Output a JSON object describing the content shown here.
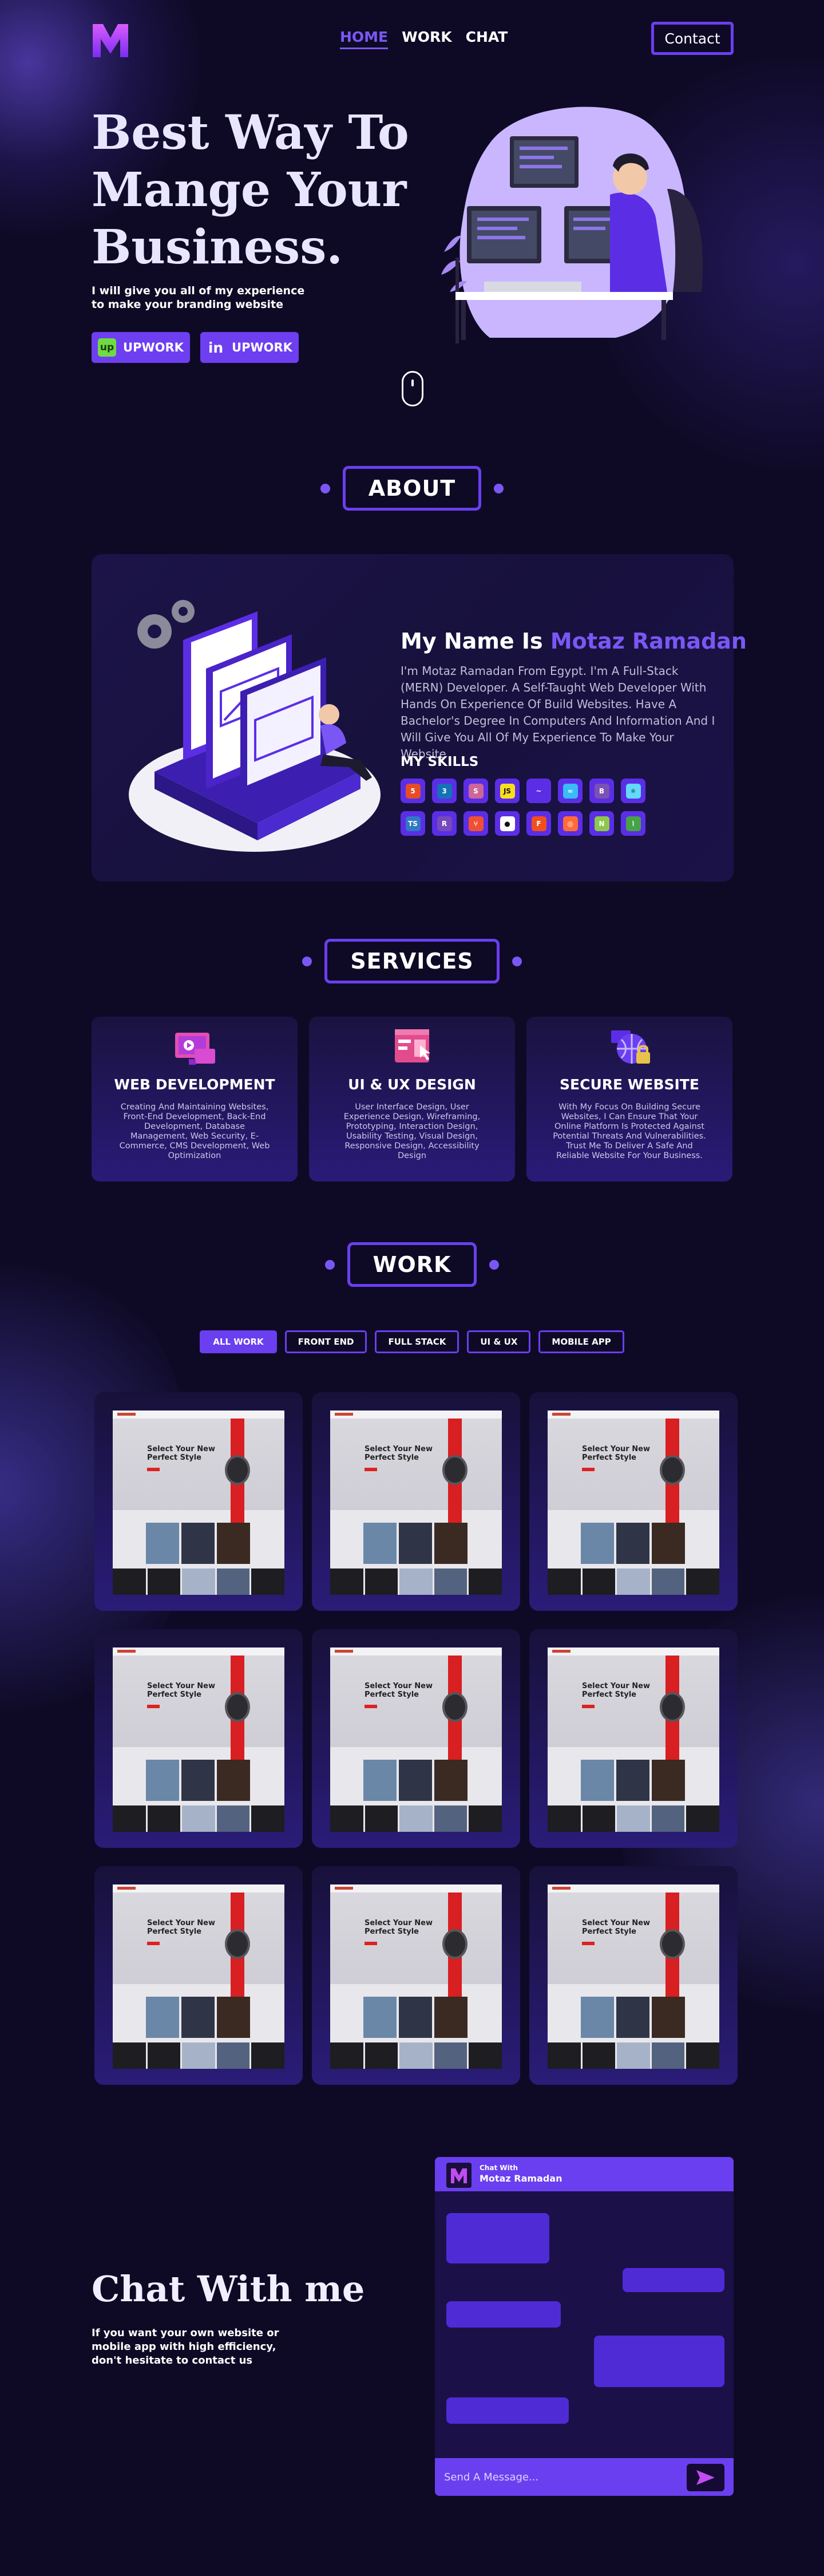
{
  "header": {
    "nav": [
      {
        "label": "HOME",
        "active": true
      },
      {
        "label": "WORK",
        "active": false
      },
      {
        "label": "CHAT",
        "active": false
      }
    ],
    "contact_label": "Contact"
  },
  "hero": {
    "title": "Best Way To Mange Your Business.",
    "subtitle": "I will give you all of my experience to make your branding website",
    "buttons": [
      {
        "label": "UPWORK",
        "icon": "upwork-icon"
      },
      {
        "label": "UPWORK",
        "icon": "linkedin-icon"
      }
    ]
  },
  "about": {
    "section_title": "ABOUT",
    "name_prefix": "My Name Is",
    "name": "Motaz Ramadan",
    "description": "I'm Motaz Ramadan From Egypt. I'm A Full-Stack (MERN) Developer. A Self-Taught Web Developer With Hands On Experience Of Build Websites. Have A Bachelor's Degree In Computers And Information And I Will Give You All Of My Experience To Make Your Website",
    "skills_title": "MY SKILLS",
    "skills": [
      {
        "icon": "html-icon",
        "color": "#e44d26",
        "glyph": "5"
      },
      {
        "icon": "css-icon",
        "color": "#1572b6",
        "glyph": "3"
      },
      {
        "icon": "sass-icon",
        "color": "#cc6699",
        "glyph": "S"
      },
      {
        "icon": "javascript-icon",
        "color": "#f7df1e",
        "glyph": "JS"
      },
      {
        "icon": "jquery-icon",
        "color": "#5b2ee6",
        "glyph": "~"
      },
      {
        "icon": "tailwind-icon",
        "color": "#38bdf8",
        "glyph": "≈"
      },
      {
        "icon": "bootstrap-icon",
        "color": "#7952b3",
        "glyph": "B"
      },
      {
        "icon": "react-icon",
        "color": "#61dafb",
        "glyph": "⚛"
      },
      {
        "icon": "typescript-icon",
        "color": "#3178c6",
        "glyph": "TS"
      },
      {
        "icon": "redux-icon",
        "color": "#764abc",
        "glyph": "R"
      },
      {
        "icon": "git-icon",
        "color": "#f05032",
        "glyph": "⑂"
      },
      {
        "icon": "github-icon",
        "color": "#ffffff",
        "glyph": "●"
      },
      {
        "icon": "figma-icon",
        "color": "#f24e1e",
        "glyph": "F"
      },
      {
        "icon": "postman-icon",
        "color": "#ff6c37",
        "glyph": "◎"
      },
      {
        "icon": "nodejs-icon",
        "color": "#8cc84b",
        "glyph": "N"
      },
      {
        "icon": "mongodb-icon",
        "color": "#47a248",
        "glyph": "⌇"
      }
    ]
  },
  "services": {
    "section_title": "SERVICES",
    "items": [
      {
        "title": "WEB DEVELOPMENT",
        "icon": "web-development-icon",
        "text": "Creating And Maintaining Websites, Front-End Development, Back-End Development, Database Management, Web Security, E-Commerce, CMS Development, Web Optimization"
      },
      {
        "title": "UI & UX DESIGN",
        "icon": "ui-ux-design-icon",
        "text": "User Interface Design, User Experience Design, Wireframing, Prototyping, Interaction Design, Usability Testing, Visual Design, Responsive Design, Accessibility Design"
      },
      {
        "title": "SECURE WEBSITE",
        "icon": "secure-website-icon",
        "text": "With My Focus On Building Secure Websites, I Can Ensure That Your Online Platform Is Protected Against Potential Threats And Vulnerabilities. Trust Me To Deliver A Safe And Reliable Website For Your Business."
      }
    ]
  },
  "work": {
    "section_title": "WORK",
    "filters": [
      {
        "label": "ALL WORK",
        "active": true
      },
      {
        "label": "FRONT END",
        "active": false
      },
      {
        "label": "FULL STACK",
        "active": false
      },
      {
        "label": "UI & UX",
        "active": false
      },
      {
        "label": "MOBILE APP",
        "active": false
      }
    ],
    "projects": [
      {
        "headline": "Select Your New Perfect Style"
      },
      {
        "headline": "Select Your New Perfect Style"
      },
      {
        "headline": "Select Your New Perfect Style"
      },
      {
        "headline": "Select Your New Perfect Style"
      },
      {
        "headline": "Select Your New Perfect Style"
      },
      {
        "headline": "Select Your New Perfect Style"
      },
      {
        "headline": "Select Your New Perfect Style"
      },
      {
        "headline": "Select Your New Perfect Style"
      },
      {
        "headline": "Select Your New Perfect Style"
      }
    ]
  },
  "chat": {
    "title": "Chat With me",
    "subtitle": "If you want your own website or mobile app with high efficiency, don't hesitate to contact us",
    "window_label": "Chat With",
    "window_name": "Motaz Ramadan",
    "input_placeholder": "Send A Message..."
  },
  "colors": {
    "background": "#0e0a25",
    "accent": "#6a3ff0",
    "accent_text": "#7a57f5"
  }
}
